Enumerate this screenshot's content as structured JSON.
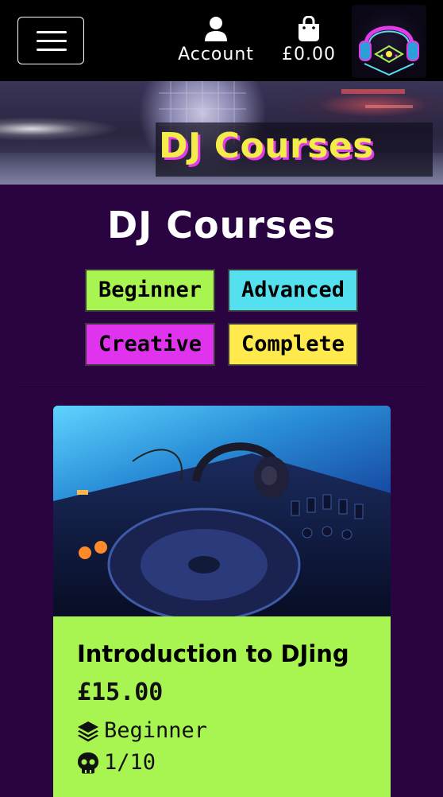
{
  "header": {
    "account_label": "Account",
    "basket_total": "£0.00",
    "icons": {
      "menu": "hamburger-menu-icon",
      "account": "user-icon",
      "basket": "shopping-bag-icon",
      "logo": "neon-headphones-logo"
    }
  },
  "hero": {
    "title": "DJ Courses"
  },
  "main": {
    "title": "DJ Courses",
    "filters": [
      {
        "label": "Beginner",
        "color": "#a8f552"
      },
      {
        "label": "Advanced",
        "color": "#55e0ef"
      },
      {
        "label": "Creative",
        "color": "#e033ee"
      },
      {
        "label": "Complete",
        "color": "#ffe94d"
      }
    ]
  },
  "courses": [
    {
      "title": "Introduction to DJing",
      "price": "£15.00",
      "level": "Beginner",
      "difficulty": "1/10",
      "icons": {
        "level": "layer-group-icon",
        "difficulty": "skull-icon"
      },
      "color": "#a8f552"
    }
  ],
  "colors": {
    "background": "#2a0440",
    "header": "#000000",
    "hero_title": "#f5ec4a",
    "hero_title_shadow": "#e23ce8"
  }
}
